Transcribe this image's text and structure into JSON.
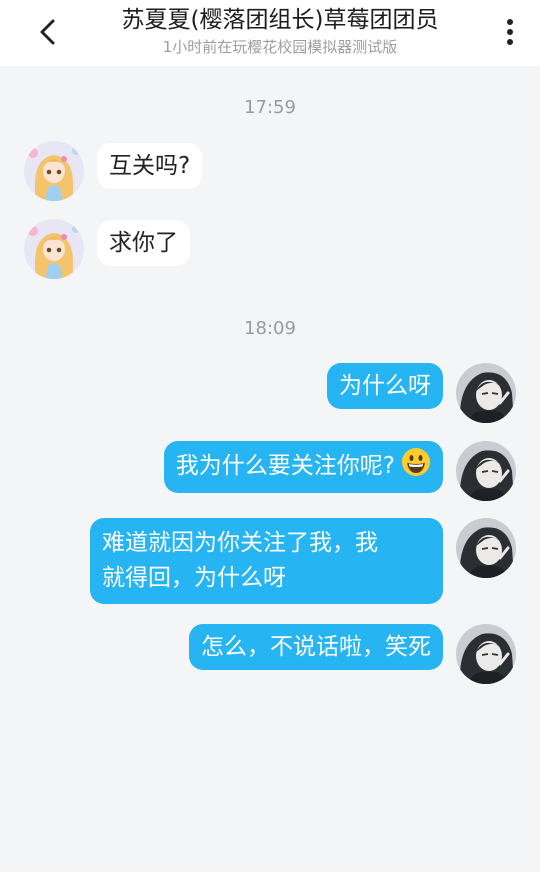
{
  "header": {
    "title": "苏夏夏(樱落团组长)草莓团团员",
    "subtitle": "1小时前在玩樱花校园模拟器测试版",
    "back_icon": "chevron-left-icon",
    "more_icon": "more-vertical-icon"
  },
  "chat": {
    "timestamps": [
      "17:59",
      "18:09"
    ],
    "incoming": [
      "互关吗?",
      "求你了"
    ],
    "outgoing": [
      "为什么呀",
      "我为什么要关注你呢?",
      "难道就因为你关注了我，我",
      "就得回，为什么呀",
      "怎么，不说话啦，笑死"
    ],
    "emoji": "grinning-face-emoji"
  },
  "colors": {
    "outgoing_bubble": "#26b4f2",
    "incoming_bubble": "#ffffff",
    "background": "#f4f5f7"
  }
}
